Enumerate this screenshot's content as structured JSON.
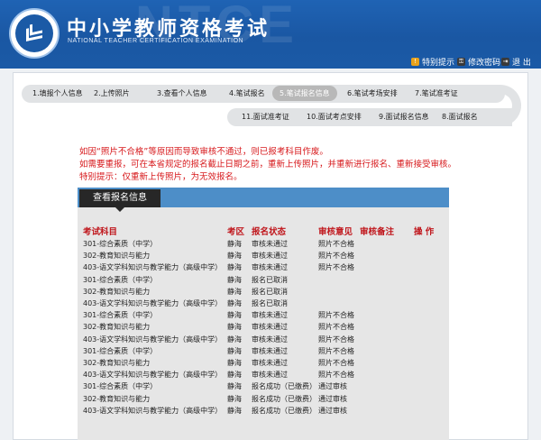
{
  "header": {
    "title": "中小学教师资格考试",
    "subtitle": "NATIONAL TEACHER CERTIFICATION EXAMINATION",
    "bg_word": "NTCE"
  },
  "toolbar": {
    "items": [
      {
        "icon": "warning-icon",
        "label": "特别提示"
      },
      {
        "icon": "key-icon",
        "label": "修改密码"
      },
      {
        "icon": "exit-icon",
        "label": "退 出"
      }
    ]
  },
  "steps": {
    "row1": [
      "1.填报个人信息",
      "2.上传照片",
      "3.查看个人信息",
      "4.笔试报名",
      "5.笔试报名信息",
      "6.笔试考场安排",
      "7.笔试准考证"
    ],
    "row2": [
      "11.面试准考证",
      "10.面试考点安排",
      "9.面试报名信息",
      "8.面试报名"
    ],
    "active_index": 4
  },
  "notices": [
    "如因“照片不合格”等原因而导致审核不通过，则已报考科目作废。",
    "如需要重报，可在本省规定的报名截止日期之前，重新上传照片，并重新进行报名、重新接受审核。",
    "特别提示：仅重新上传照片，为无效报名。"
  ],
  "section": {
    "tab_label": "查看报名信息"
  },
  "table": {
    "headers": [
      "考试科目",
      "考区",
      "报名状态",
      "审核意见",
      "审核备注",
      "操 作"
    ],
    "rows": [
      [
        "301-综合素质（中学）",
        "静海",
        "审核未通过",
        "照片不合格",
        "",
        ""
      ],
      [
        "302-教育知识与能力",
        "静海",
        "审核未通过",
        "照片不合格",
        "",
        ""
      ],
      [
        "403-语文学科知识与教学能力（高级中学）",
        "静海",
        "审核未通过",
        "照片不合格",
        "",
        ""
      ],
      [
        "301-综合素质（中学）",
        "静海",
        "报名已取消",
        "",
        "",
        ""
      ],
      [
        "302-教育知识与能力",
        "静海",
        "报名已取消",
        "",
        "",
        ""
      ],
      [
        "403-语文学科知识与教学能力（高级中学）",
        "静海",
        "报名已取消",
        "",
        "",
        ""
      ],
      [
        "301-综合素质（中学）",
        "静海",
        "审核未通过",
        "照片不合格",
        "",
        ""
      ],
      [
        "302-教育知识与能力",
        "静海",
        "审核未通过",
        "照片不合格",
        "",
        ""
      ],
      [
        "403-语文学科知识与教学能力（高级中学）",
        "静海",
        "审核未通过",
        "照片不合格",
        "",
        ""
      ],
      [
        "301-综合素质（中学）",
        "静海",
        "审核未通过",
        "照片不合格",
        "",
        ""
      ],
      [
        "302-教育知识与能力",
        "静海",
        "审核未通过",
        "照片不合格",
        "",
        ""
      ],
      [
        "403-语文学科知识与教学能力（高级中学）",
        "静海",
        "审核未通过",
        "照片不合格",
        "",
        ""
      ],
      [
        "301-综合素质（中学）",
        "静海",
        "报名成功（已缴费）",
        "通过审核",
        "",
        ""
      ],
      [
        "302-教育知识与能力",
        "静海",
        "报名成功（已缴费）",
        "通过审核",
        "",
        ""
      ],
      [
        "403-语文学科知识与教学能力（高级中学）",
        "静海",
        "报名成功（已缴费）",
        "通过审核",
        "",
        ""
      ]
    ]
  },
  "colors": {
    "header_blue": "#1b5aa6",
    "notice_red": "#d7191c",
    "stripe_blue": "#4d8ec8"
  }
}
